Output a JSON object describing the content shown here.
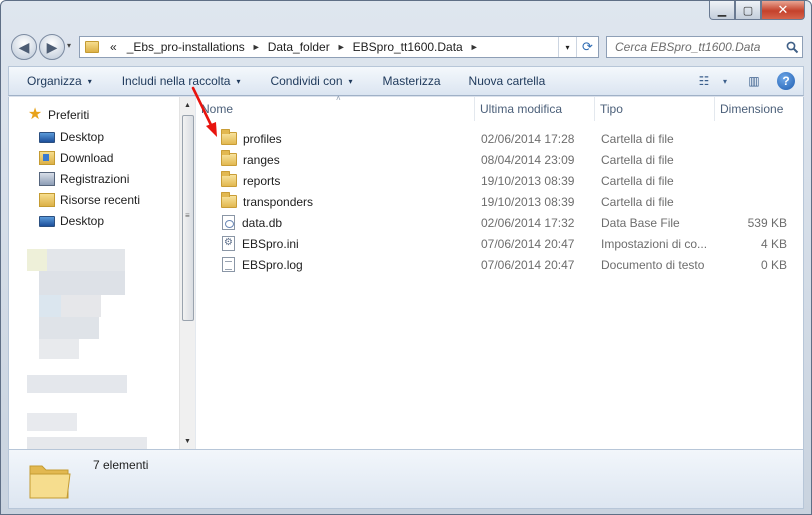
{
  "window": {
    "caption_buttons": {
      "minimize": "▁",
      "maximize": "▢",
      "close": "✕"
    }
  },
  "address": {
    "overflow": "«",
    "breadcrumbs": [
      "_Ebs_pro-installations",
      "Data_folder",
      "EBSpro_tt1600.Data"
    ],
    "separator": "►",
    "dropdown_glyph": "▾",
    "refresh_glyph": "⟳"
  },
  "search": {
    "placeholder": "Cerca EBSpro_tt1600.Data"
  },
  "nav_buttons": {
    "back": "◀",
    "forward": "▶",
    "dropdown": "▾"
  },
  "toolbar": {
    "organize": "Organizza",
    "include": "Includi nella raccolta",
    "share": "Condividi con",
    "burn": "Masterizza",
    "new_folder": "Nuova cartella",
    "caret": "▾",
    "views_glyph": "☷",
    "preview_glyph": "▥",
    "help_glyph": "?"
  },
  "sidebar": {
    "favorites_label": "Preferiti",
    "items": [
      {
        "label": "Desktop",
        "icon": "desktop-icon"
      },
      {
        "label": "Download",
        "icon": "download-folder-icon"
      },
      {
        "label": "Registrazioni",
        "icon": "recordings-icon"
      },
      {
        "label": "Risorse recenti",
        "icon": "recent-places-icon"
      },
      {
        "label": "Desktop",
        "icon": "desktop-icon"
      }
    ],
    "scroll_up": "▲",
    "scroll_down": "▼",
    "grip": "≡"
  },
  "columns": {
    "name": "Nome",
    "modified": "Ultima modifica",
    "type": "Tipo",
    "size": "Dimensione",
    "sort_glyph": "˄"
  },
  "files": [
    {
      "name": "profiles",
      "modified": "02/06/2014 17:28",
      "type": "Cartella di file",
      "size": "",
      "icon": "folder-icon"
    },
    {
      "name": "ranges",
      "modified": "08/04/2014 23:09",
      "type": "Cartella di file",
      "size": "",
      "icon": "folder-icon"
    },
    {
      "name": "reports",
      "modified": "19/10/2013 08:39",
      "type": "Cartella di file",
      "size": "",
      "icon": "folder-icon"
    },
    {
      "name": "transponders",
      "modified": "19/10/2013 08:39",
      "type": "Cartella di file",
      "size": "",
      "icon": "folder-icon"
    },
    {
      "name": "data.db",
      "modified": "02/06/2014 17:32",
      "type": "Data Base File",
      "size": "539 KB",
      "icon": "database-file-icon"
    },
    {
      "name": "EBSpro.ini",
      "modified": "07/06/2014 20:47",
      "type": "Impostazioni di co...",
      "size": "4 KB",
      "icon": "settings-file-icon"
    },
    {
      "name": "EBSpro.log",
      "modified": "07/06/2014 20:47",
      "type": "Documento di testo",
      "size": "0 KB",
      "icon": "text-file-icon"
    }
  ],
  "status": {
    "count": "7 elementi"
  },
  "colors": {
    "annotation_arrow": "#e8140e",
    "toolbar_text": "#1e395b",
    "muted_text": "#6d6d6d",
    "folder": "#e2b850"
  }
}
